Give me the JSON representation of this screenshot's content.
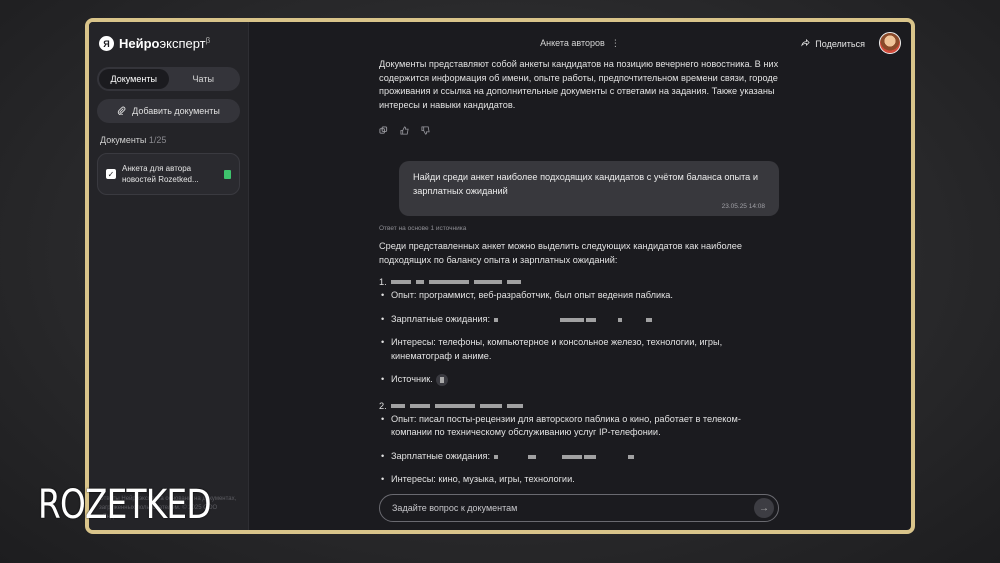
{
  "app": {
    "logo_bold": "Нейро",
    "logo_rest": "эксперт",
    "logo_beta": "β",
    "logo_mark": "Я"
  },
  "sidebar": {
    "tabs": [
      {
        "label": "Документы",
        "active": true
      },
      {
        "label": "Чаты",
        "active": false
      }
    ],
    "add_button": "Добавить документы",
    "docs_label": "Документы",
    "docs_count": "1/25",
    "documents": [
      {
        "title": "Анкета для автора новостей Rozetked..."
      }
    ],
    "footer": "Ответы Нейроэксперта основаны на документах, загруженных пользователем. © 2025 ООО «Яндекс»"
  },
  "topbar": {
    "title": "Анкета авторов",
    "share": "Поделиться"
  },
  "chat": {
    "summary": "Документы представляют собой анкеты кандидатов на позицию вечернего новостника. В них содержится информация об имени, опыте работы, предпочтительном времени связи, городе проживания и ссылка на дополнительные документы с ответами на задания. Также указаны интересы и навыки кандидатов.",
    "user_message": "Найди среди анкет наиболее подходящих кандидатов с учётом баланса опыта и зарплатных ожиданий",
    "user_time": "23.05.25 14:08",
    "answer_note": "Ответ на основе 1 источника",
    "answer_intro": "Среди представленных анкет можно выделить следующих кандидатов как наиболее подходящих по балансу опыта и зарплатных ожиданий:",
    "candidates": [
      {
        "num": "1.",
        "experience": "Опыт: программист, веб-разработчик, был опыт ведения паблика.",
        "salary": "Зарплатные ожидания:",
        "interests": "Интересы: телефоны, компьютерное и консольное железо, технологии, игры, кинематограф и аниме.",
        "source": "Источник."
      },
      {
        "num": "2.",
        "experience": "Опыт: писал посты-рецензии для авторского паблика о кино, работает в телеком-компании по техническому обслуживанию услуг IP-телефонии.",
        "salary": "Зарплатные ожидания:",
        "interests": "Интересы: кино, музыка, игры, технологии."
      }
    ],
    "input_placeholder": "Задайте вопрос к документам"
  },
  "watermark": "ROZETKED",
  "colors": {
    "frame_border": "#d9c48a",
    "accent_green": "#3ec46d"
  }
}
